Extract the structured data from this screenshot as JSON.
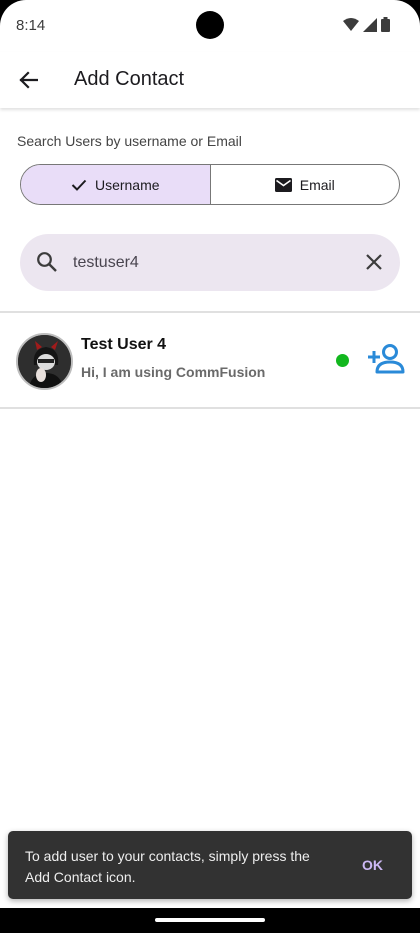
{
  "status_bar": {
    "time": "8:14",
    "icons": [
      "wifi-icon",
      "signal-icon",
      "battery-icon"
    ]
  },
  "app_bar": {
    "back_icon": "arrow-back-icon",
    "title": "Add Contact"
  },
  "search": {
    "hint": "Search Users by username or Email",
    "modes": [
      {
        "label": "Username",
        "icon": "check-icon",
        "selected": true
      },
      {
        "label": "Email",
        "icon": "mail-icon",
        "selected": false
      }
    ],
    "value": "testuser4",
    "placeholder": ""
  },
  "results": [
    {
      "name": "Test User 4",
      "status": "Hi, I am using CommFusion",
      "online": true,
      "action_icon": "person-add-icon"
    }
  ],
  "snackbar": {
    "message": "To add user to your contacts, simply press the Add Contact icon.",
    "action": "OK"
  },
  "colors": {
    "accent": "#e9ddf8",
    "search_bg": "#ece6f0",
    "online": "#12b71e",
    "add_icon": "#2a8ad8",
    "snackbar_bg": "#323232",
    "snackbar_action": "#cdb8f5"
  }
}
